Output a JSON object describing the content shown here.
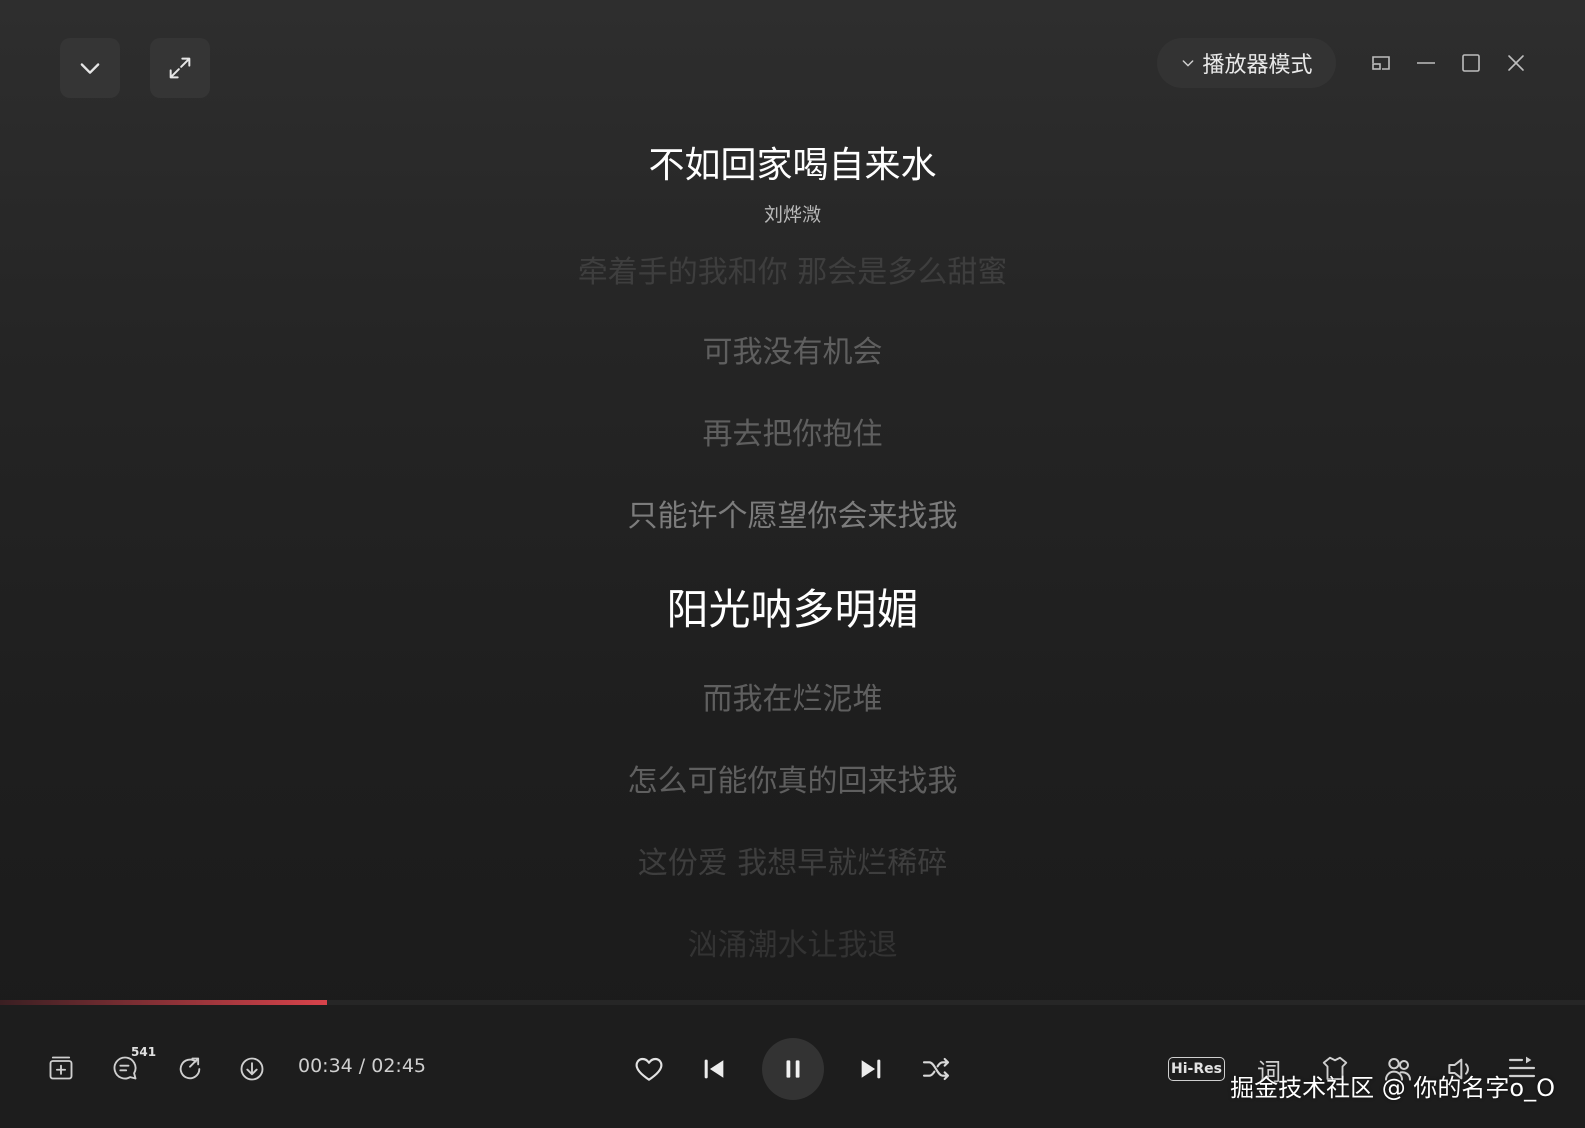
{
  "header": {
    "mode_label": "播放器模式"
  },
  "song": {
    "title": "不如回家喝自来水",
    "artist": "刘烨溦"
  },
  "lyrics": [
    {
      "text": "牵着手的我和你 那会是多么甜蜜",
      "state": "faded"
    },
    {
      "text": "可我没有机会",
      "state": "dim"
    },
    {
      "text": "再去把你抱住",
      "state": "dim"
    },
    {
      "text": "只能许个愿望你会来找我",
      "state": "normal"
    },
    {
      "text": "阳光呐多明媚",
      "state": "current"
    },
    {
      "text": "而我在烂泥堆",
      "state": "dim"
    },
    {
      "text": "怎么可能你真的回来找我",
      "state": "dim"
    },
    {
      "text": "这份爱 我想早就烂稀碎",
      "state": "faded"
    },
    {
      "text": "汹涌潮水让我退",
      "state": "faded2"
    }
  ],
  "playback": {
    "current_time": "00:34",
    "total_time": "02:45",
    "time_display": "00:34 / 02:45",
    "progress": 0.206
  },
  "controls": {
    "comment_count": "541",
    "quality_label": "Hi-Res",
    "lyrics_label": "词"
  },
  "watermark": "掘金技术社区 @ 你的名字o_O",
  "colors": {
    "accent": "#d8434b",
    "background": "#1e1e1e"
  }
}
